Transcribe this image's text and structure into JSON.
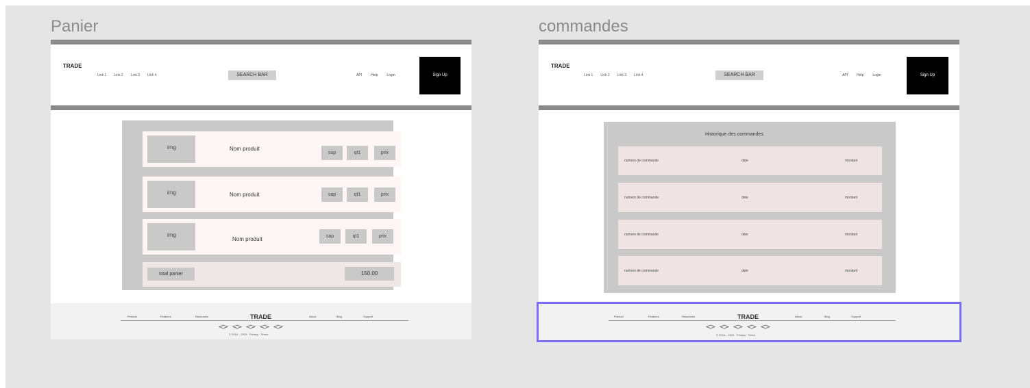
{
  "frames": {
    "panier": {
      "label": "Panier",
      "header": {
        "logo": "TRADE",
        "nav_links": [
          "Link 1",
          "Link 2",
          "Link 3",
          "Link 4"
        ],
        "search": "SEARCH BAR",
        "actions": [
          "API",
          "Help",
          "Login"
        ],
        "signup": "Sign Up"
      },
      "cart": {
        "items": [
          {
            "img": "img",
            "name": "Nom produit",
            "buttons": [
              "sup",
              "qt1",
              "prix"
            ]
          },
          {
            "img": "img",
            "name": "Nom produit",
            "buttons": [
              "sap",
              "qt1",
              "prix"
            ]
          },
          {
            "img": "img",
            "name": "Nom produit",
            "buttons": [
              "sap",
              "qt1",
              "prix"
            ]
          }
        ],
        "total_label": "total panier",
        "total_value": "150.00"
      },
      "footer": {
        "left_links": [
          "Product",
          "Features",
          "Resources"
        ],
        "logo": "TRADE",
        "right_links": [
          "About",
          "Blog",
          "Support"
        ],
        "copyright": "© 2016 – 2024 · Privacy · Terms"
      }
    },
    "commandes": {
      "label": "commandes",
      "header": {
        "logo": "TRADE",
        "nav_links": [
          "Link 1",
          "Link 2",
          "Link 3",
          "Link 4"
        ],
        "search": "SEARCH BAR",
        "actions": [
          "API",
          "Help",
          "Login"
        ],
        "signup": "Sign Up"
      },
      "orders": {
        "title": "Historique des commandes",
        "rows": [
          {
            "number": "numero de commande",
            "date": "date",
            "amount": "montant"
          },
          {
            "number": "numero de commande",
            "date": "date",
            "amount": "montant"
          },
          {
            "number": "numero de commande",
            "date": "date",
            "amount": "montant"
          },
          {
            "number": "numero de commande",
            "date": "date",
            "amount": "montant"
          }
        ]
      },
      "footer": {
        "left_links": [
          "Product",
          "Features",
          "Resources"
        ],
        "logo": "TRADE",
        "right_links": [
          "About",
          "Blog",
          "Support"
        ],
        "copyright": "© 2016 – 2024 · Privacy · Terms"
      }
    }
  }
}
